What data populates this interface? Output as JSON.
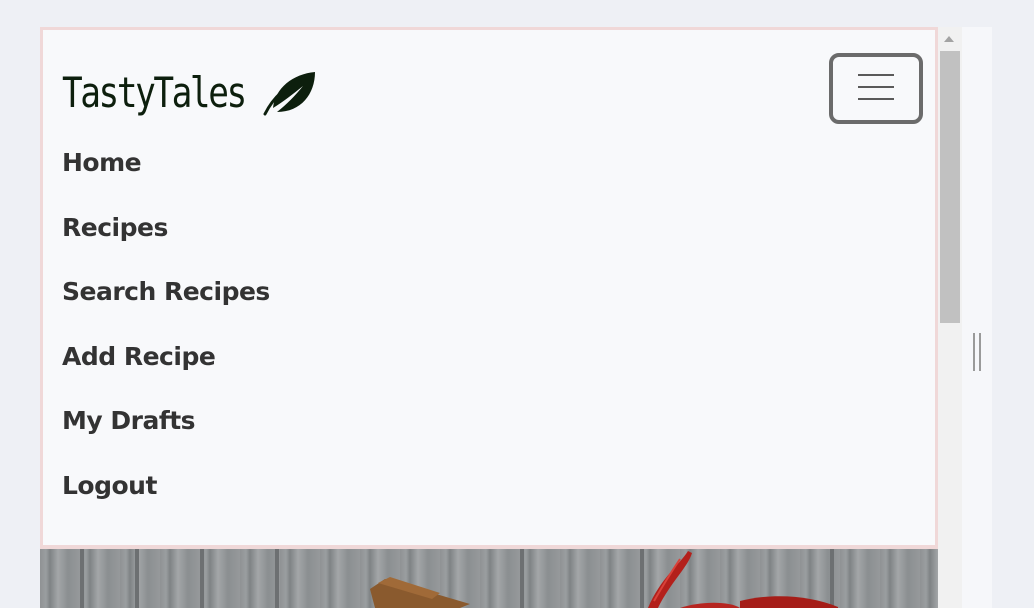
{
  "brand": {
    "name": "TastyTales",
    "logo_icon": "leaf-icon"
  },
  "navbar": {
    "toggler_icon": "hamburger-menu-icon",
    "items": [
      {
        "label": "Home"
      },
      {
        "label": "Recipes"
      },
      {
        "label": "Search Recipes"
      },
      {
        "label": "Add Recipe"
      },
      {
        "label": "My Drafts"
      },
      {
        "label": "Logout"
      }
    ]
  },
  "colors": {
    "background": "#eef0f5",
    "navbar_bg": "#f8f9fb",
    "navbar_border": "#f0d8d8",
    "brand": "#0d1f0d",
    "link": "#333333"
  }
}
